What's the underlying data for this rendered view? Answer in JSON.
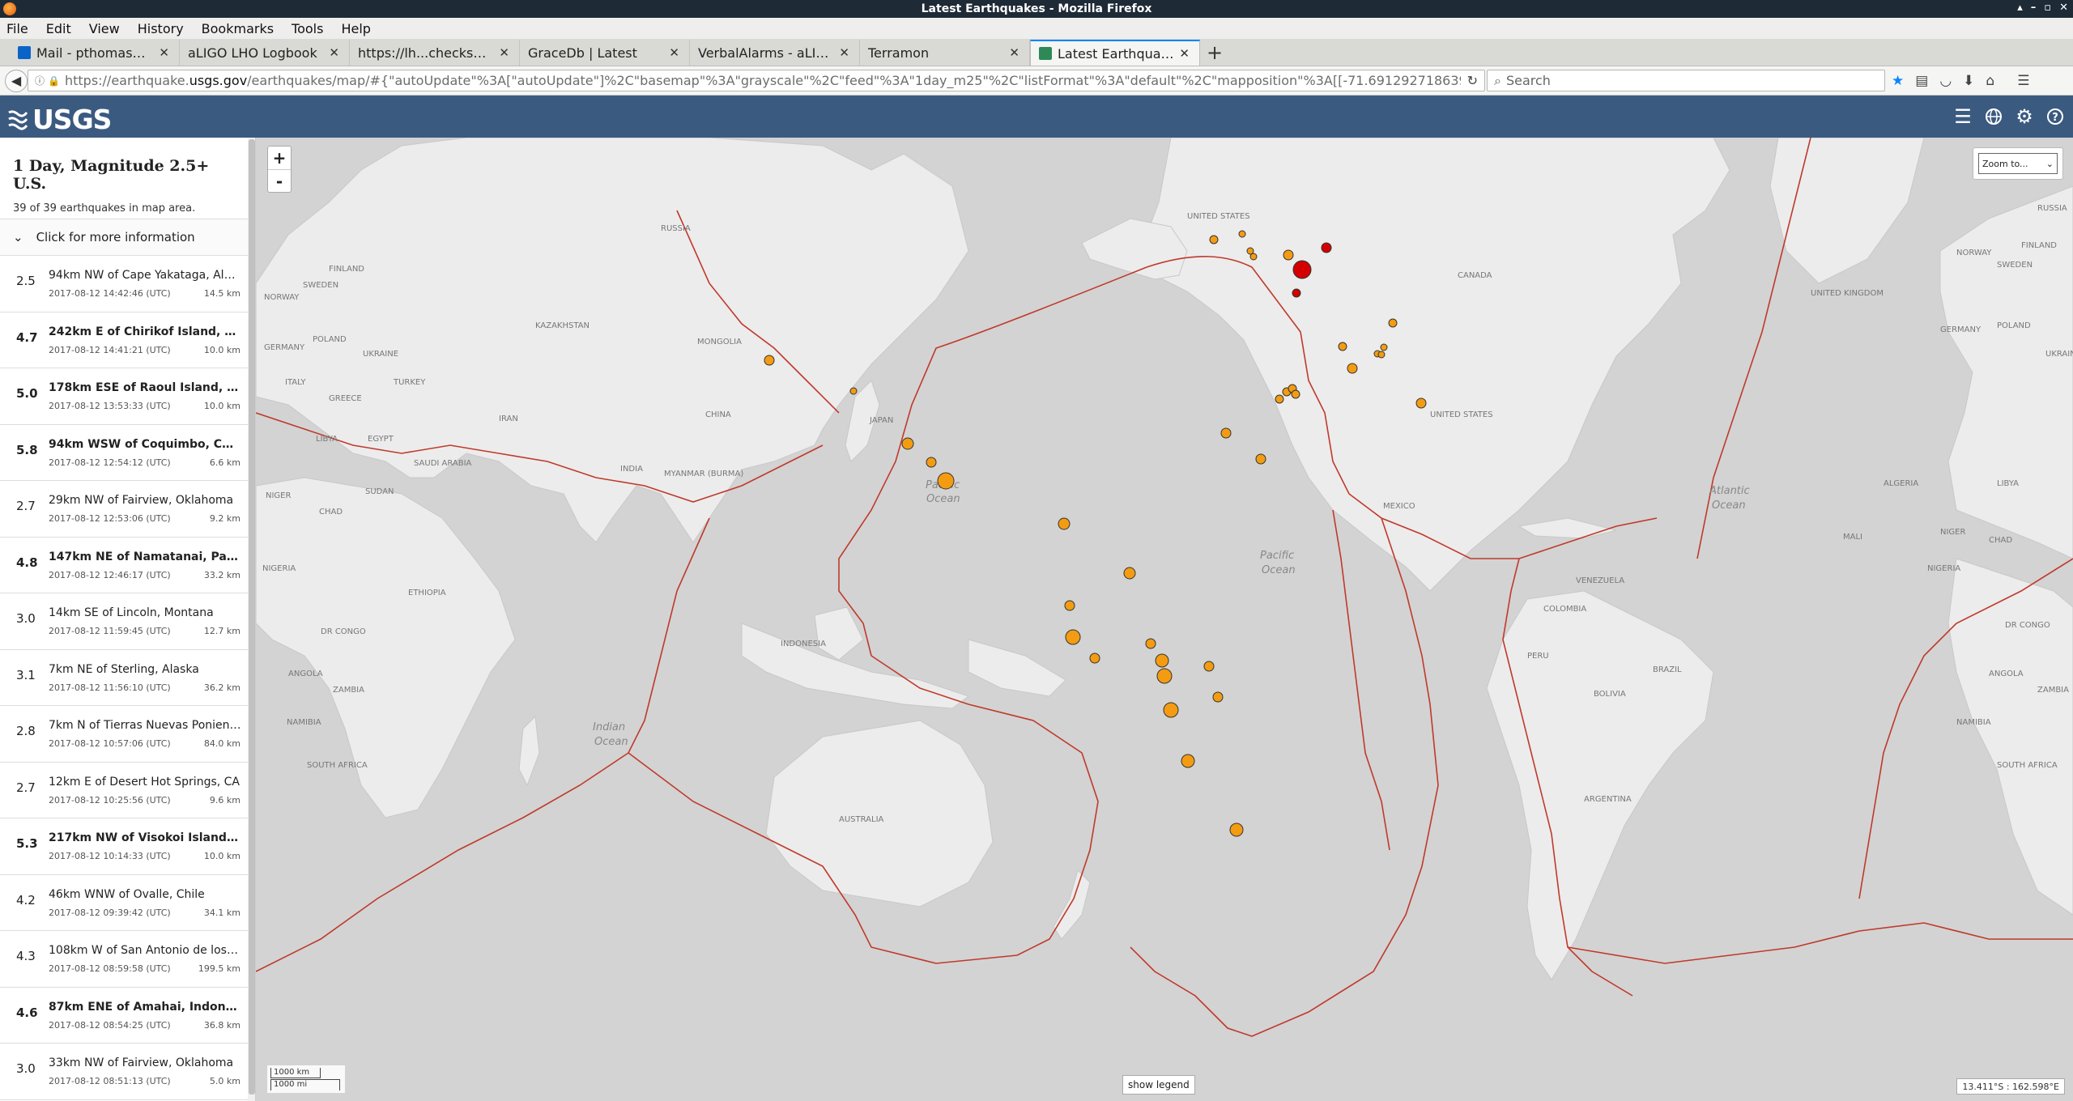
{
  "window": {
    "title": "Latest Earthquakes - Mozilla Firefox"
  },
  "menu": [
    "File",
    "Edit",
    "View",
    "History",
    "Bookmarks",
    "Tools",
    "Help"
  ],
  "tabs": [
    {
      "label": "Mail - pthomas@c...",
      "favicon_color": "#0a64c8"
    },
    {
      "label": "aLIGO LHO Logbook",
      "favicon_color": ""
    },
    {
      "label": "https://lh...checksheet",
      "favicon_color": ""
    },
    {
      "label": "GraceDb | Latest",
      "favicon_color": ""
    },
    {
      "label": "VerbalAlarms - aLIG...",
      "favicon_color": ""
    },
    {
      "label": "Terramon",
      "favicon_color": ""
    },
    {
      "label": "Latest Earthquakes",
      "favicon_color": "#2d8a58",
      "active": true
    }
  ],
  "nav": {
    "url_prefix": "https://earthquake.",
    "url_domain": "usgs.gov",
    "url_rest": "/earthquakes/map/#{\"autoUpdate\"%3A[\"autoUpdate\"]%2C\"basemap\"%3A\"grayscale\"%2C\"feed\"%3A\"1day_m25\"%2C\"listFormat\"%3A\"default\"%2C\"mapposition\"%3A[[-71.69129271863997%2",
    "search_placeholder": "Search"
  },
  "usgs": {
    "logo_text": "USGS",
    "brand_color": "#3b5a80"
  },
  "sidebar": {
    "title": "1 Day, Magnitude 2.5+ U.S.",
    "count": "39 of 39 earthquakes in map area.",
    "more_info": "Click for more information",
    "quakes": [
      {
        "mag": "2.5",
        "place": "94km NW of Cape Yakataga, Alaska",
        "time": "2017-08-12 14:42:46 (UTC)",
        "depth": "14.5 km"
      },
      {
        "mag": "4.7",
        "place": "242km E of Chirikof Island, Alaska",
        "time": "2017-08-12 14:41:21 (UTC)",
        "depth": "10.0 km",
        "big": true
      },
      {
        "mag": "5.0",
        "place": "178km ESE of Raoul Island, New ...",
        "time": "2017-08-12 13:53:33 (UTC)",
        "depth": "10.0 km",
        "big": true
      },
      {
        "mag": "5.8",
        "place": "94km WSW of Coquimbo, Chile",
        "time": "2017-08-12 12:54:12 (UTC)",
        "depth": "6.6 km",
        "big": true
      },
      {
        "mag": "2.7",
        "place": "29km NW of Fairview, Oklahoma",
        "time": "2017-08-12 12:53:06 (UTC)",
        "depth": "9.2 km"
      },
      {
        "mag": "4.8",
        "place": "147km NE of Namatanai, Papua ...",
        "time": "2017-08-12 12:46:17 (UTC)",
        "depth": "33.2 km",
        "big": true
      },
      {
        "mag": "3.0",
        "place": "14km SE of Lincoln, Montana",
        "time": "2017-08-12 11:59:45 (UTC)",
        "depth": "12.7 km"
      },
      {
        "mag": "3.1",
        "place": "7km NE of Sterling, Alaska",
        "time": "2017-08-12 11:56:10 (UTC)",
        "depth": "36.2 km"
      },
      {
        "mag": "2.8",
        "place": "7km N of Tierras Nuevas Poniente, ...",
        "time": "2017-08-12 10:57:06 (UTC)",
        "depth": "84.0 km"
      },
      {
        "mag": "2.7",
        "place": "12km E of Desert Hot Springs, CA",
        "time": "2017-08-12 10:25:56 (UTC)",
        "depth": "9.6 km"
      },
      {
        "mag": "5.3",
        "place": "217km NW of Visokoi Island, Sou...",
        "time": "2017-08-12 10:14:33 (UTC)",
        "depth": "10.0 km",
        "big": true
      },
      {
        "mag": "4.2",
        "place": "46km WNW of Ovalle, Chile",
        "time": "2017-08-12 09:39:42 (UTC)",
        "depth": "34.1 km"
      },
      {
        "mag": "4.3",
        "place": "108km W of San Antonio de los Cob...",
        "time": "2017-08-12 08:59:58 (UTC)",
        "depth": "199.5 km"
      },
      {
        "mag": "4.6",
        "place": "87km ENE of Amahai, Indonesia",
        "time": "2017-08-12 08:54:25 (UTC)",
        "depth": "36.8 km",
        "big": true
      },
      {
        "mag": "3.0",
        "place": "33km NW of Fairview, Oklahoma",
        "time": "2017-08-12 08:51:13 (UTC)",
        "depth": "5.0 km"
      }
    ]
  },
  "map": {
    "zoom_in": "+",
    "zoom_out": "-",
    "zoom_to": "Zoom to...",
    "scale_km": "1000 km",
    "scale_mi": "1000 mi",
    "show_legend": "show legend",
    "coords": "13.411°S : 162.598°E",
    "labels": {
      "russia": "RUSSIA",
      "kazakhstan": "KAZAKHSTAN",
      "mongolia": "MONGOLIA",
      "china": "CHINA",
      "india": "INDIA",
      "iran": "IRAN",
      "turkey": "TURKEY",
      "saudi": "SAUDI ARABIA",
      "egypt": "EGYPT",
      "libya": "LIBYA",
      "algeria": "ALGERIA",
      "mali": "MALI",
      "niger": "NIGER",
      "chad": "CHAD",
      "sudan": "SUDAN",
      "nigeria": "NIGERIA",
      "ethiopia": "ETHIOPIA",
      "drcongo": "DR CONGO",
      "angola": "ANGOLA",
      "zambia": "ZAMBIA",
      "namibia": "NAMIBIA",
      "southafrica": "SOUTH AFRICA",
      "mexico": "MEXICO",
      "canada": "CANADA",
      "unitedstates": "UNITED STATES",
      "venezuela": "VENEZUELA",
      "colombia": "COLOMBIA",
      "peru": "PERU",
      "bolivia": "BOLIVIA",
      "brazil": "BRAZIL",
      "argentina": "ARGENTINA",
      "australia": "AUSTRALIA",
      "indonesia": "INDONESIA",
      "myanmar": "MYANMAR (BURMA)",
      "japan": "JAPAN",
      "sweden": "SWEDEN",
      "norway": "NORWAY",
      "finland": "FINLAND",
      "germany": "GERMANY",
      "poland": "POLAND",
      "ukraine": "UKRAINE",
      "italy": "ITALY",
      "greece": "GREECE",
      "unitedkingdom": "UNITED KINGDOM",
      "pacific": "Pacific",
      "ocean": "Ocean",
      "indian": "Indian",
      "atlantic": "Atlantic"
    },
    "colors": {
      "quake_orange": "#f39c12",
      "quake_red": "#d40000",
      "plate_line": "#c0392b",
      "land": "#ececec",
      "water": "#d3d3d3"
    }
  }
}
